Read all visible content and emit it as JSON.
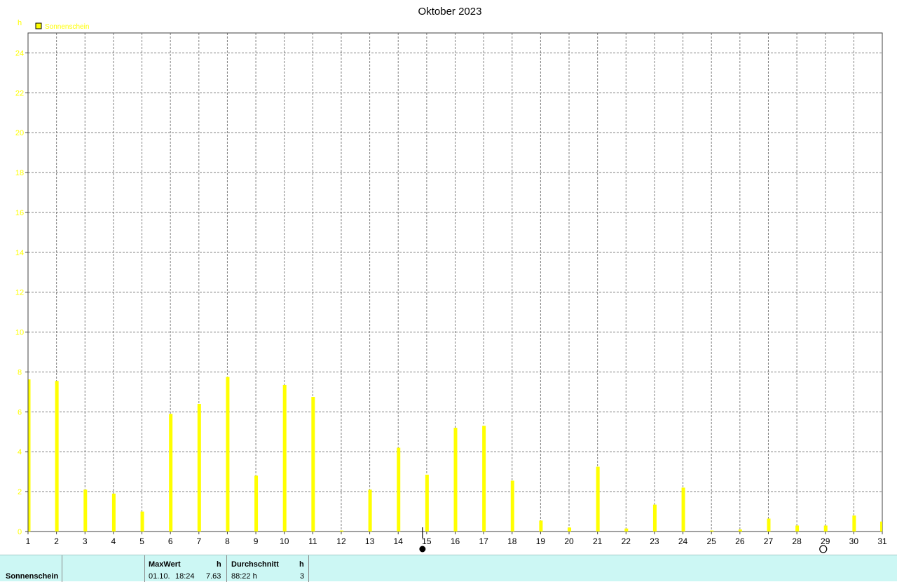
{
  "chart_data": {
    "type": "bar",
    "title": "Oktober 2023",
    "ylabel": "h",
    "ylim": [
      0,
      25
    ],
    "yticks": [
      0,
      2,
      4,
      6,
      8,
      10,
      12,
      14,
      16,
      18,
      20,
      22,
      24
    ],
    "grid": true,
    "legend_position": "top-left",
    "categories": [
      "1",
      "2",
      "3",
      "4",
      "5",
      "6",
      "7",
      "8",
      "9",
      "10",
      "11",
      "12",
      "13",
      "14",
      "15",
      "16",
      "17",
      "18",
      "19",
      "20",
      "21",
      "22",
      "23",
      "24",
      "25",
      "26",
      "27",
      "28",
      "29",
      "30",
      "31"
    ],
    "series": [
      {
        "name": "Sonnenschein",
        "color": "#ffff00",
        "values": [
          7.63,
          7.55,
          2.1,
          1.9,
          1.0,
          5.9,
          6.4,
          7.75,
          2.8,
          7.35,
          6.75,
          0.05,
          2.1,
          4.2,
          2.85,
          5.2,
          5.3,
          2.55,
          0.55,
          0.2,
          3.25,
          0.15,
          1.35,
          2.2,
          0.05,
          0.1,
          0.65,
          0.3,
          0.3,
          0.8,
          0.5
        ]
      }
    ],
    "moon_phases": [
      {
        "day": 15,
        "phase": "new-moon",
        "icon": "filled-circle-icon"
      },
      {
        "day": 29,
        "phase": "full-moon",
        "icon": "open-circle-icon"
      }
    ]
  },
  "colors": {
    "bar": "#ffff00",
    "axis_text_y": "#ffff00",
    "grid": "#808080",
    "stat_background": "#ccf7f4"
  },
  "stats": {
    "series_label": "Sonnenschein",
    "max_header": "MaxWert",
    "max_unit": "h",
    "max_date": "01.10.",
    "max_time": "18:24",
    "max_value": "7.63",
    "avg_header": "Durchschnitt",
    "avg_unit": "h",
    "avg_value": "88:22 h",
    "avg_count": "3"
  }
}
